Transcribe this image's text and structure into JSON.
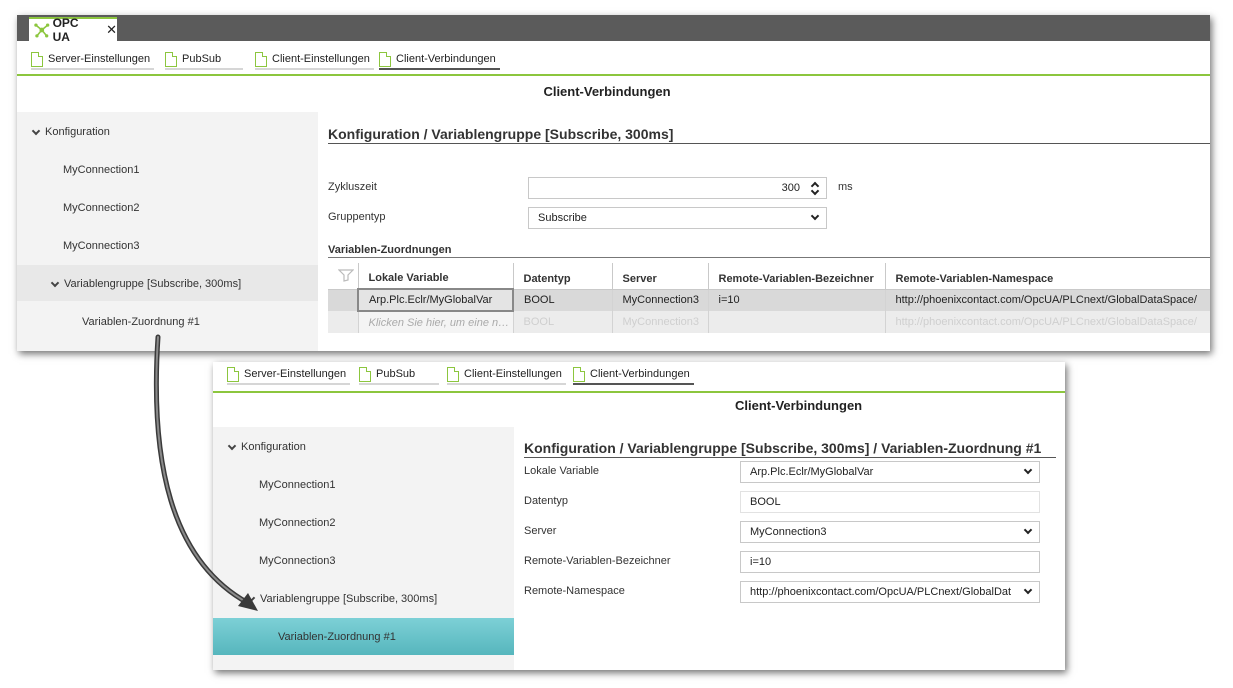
{
  "app_tab": {
    "label": "OPC UA",
    "close": "✕"
  },
  "tabs": [
    "Server-Einstellungen",
    "PubSub",
    "Client-Einstellungen",
    "Client-Verbindungen"
  ],
  "page_title": "Client-Verbindungen",
  "tree": {
    "root": "Konfiguration",
    "connections": [
      "MyConnection1",
      "MyConnection2",
      "MyConnection3"
    ],
    "group": "Variablengruppe [Subscribe, 300ms]",
    "mapping": "Variablen-Zuordnung  #1"
  },
  "panel1": {
    "heading": "Konfiguration / Variablengruppe [Subscribe, 300ms]",
    "cycle_label": "Zykluszeit",
    "cycle_value": "300",
    "cycle_unit": "ms",
    "group_type_label": "Gruppentyp",
    "group_type_value": "Subscribe",
    "section_title": "Variablen-Zuordnungen",
    "columns": [
      "Lokale Variable",
      "Datentyp",
      "Server",
      "Remote-Variablen-Bezeichner",
      "Remote-Variablen-Namespace"
    ],
    "row": [
      "Arp.Plc.Eclr/MyGlobalVar",
      "BOOL",
      "MyConnection3",
      "i=10",
      "http://phoenixcontact.com/OpcUA/PLCnext/GlobalDataSpace/"
    ],
    "placeholder_row": [
      "Klicken Sie hier, um eine n…",
      "BOOL",
      "MyConnection3",
      "",
      "http://phoenixcontact.com/OpcUA/PLCnext/GlobalDataSpace/"
    ]
  },
  "panel2": {
    "heading": "Konfiguration / Variablengruppe [Subscribe, 300ms] / Variablen-Zuordnung  #1",
    "fields": [
      {
        "label": "Lokale Variable",
        "value": "Arp.Plc.Eclr/MyGlobalVar"
      },
      {
        "label": "Datentyp",
        "value": "BOOL"
      },
      {
        "label": "Server",
        "value": "MyConnection3"
      },
      {
        "label": "Remote-Variablen-Bezeichner",
        "value": "i=10"
      },
      {
        "label": "Remote-Namespace",
        "value": "http://phoenixcontact.com/OpcUA/PLCnext/GlobalDat"
      }
    ]
  },
  "colors": {
    "accent": "#8cc63e",
    "selected": "#6cc5cc",
    "titlebar": "#5b5b5b"
  },
  "icons": [
    "opc-ua-network-icon",
    "document-icon",
    "chevron-down-icon",
    "select-arrow-icon",
    "spin-icon",
    "pointer-arrow"
  ]
}
